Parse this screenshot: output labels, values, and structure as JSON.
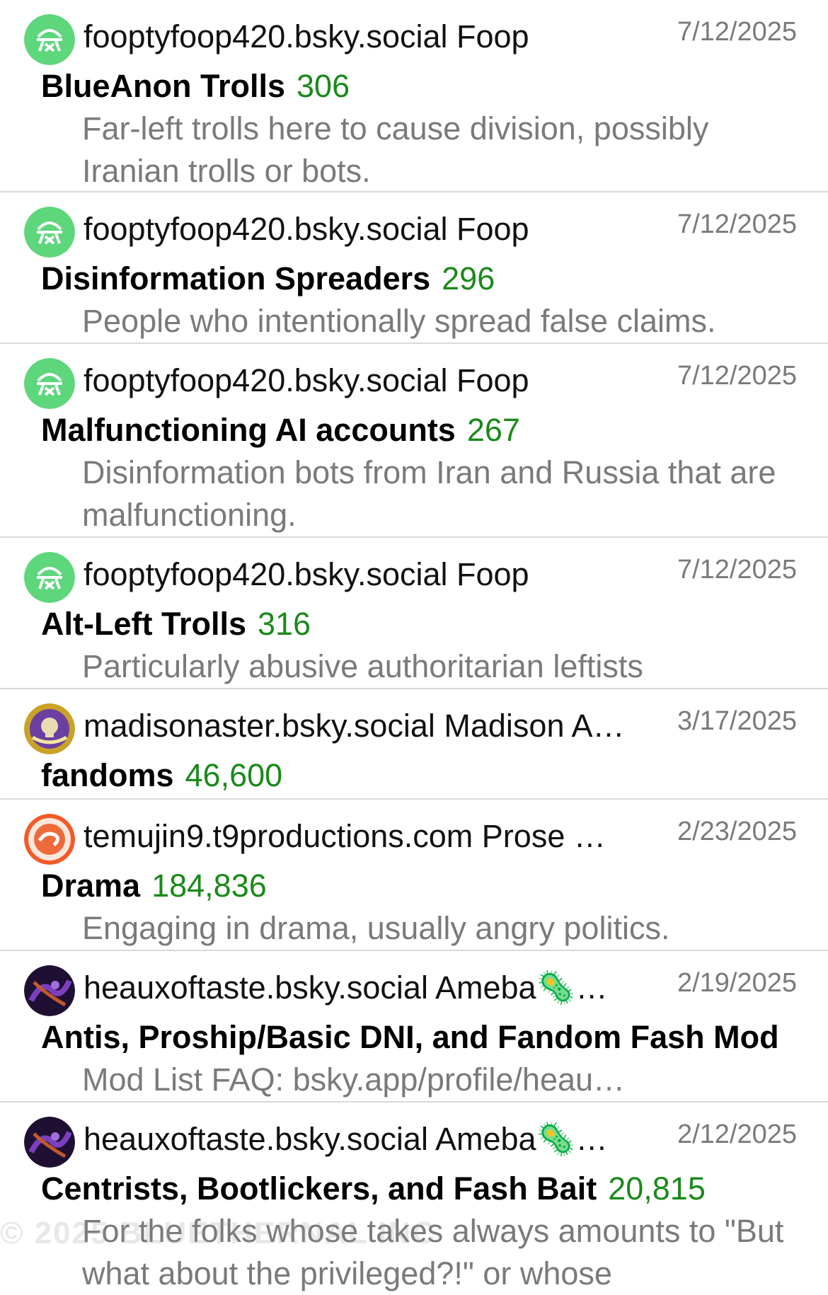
{
  "feeds": [
    {
      "author": "fooptyfoop420.bsky.social Foop",
      "date": "7/12/2025",
      "title": "BlueAnon Trolls",
      "count": "306",
      "description": "Far-left trolls here to cause division, possibly Iranian trolls or bots.",
      "avatar": "green-bsky-avatar"
    },
    {
      "author": "fooptyfoop420.bsky.social Foop",
      "date": "7/12/2025",
      "title": "Disinformation Spreaders",
      "count": "296",
      "description": "People who intentionally spread false claims.",
      "avatar": "green-bsky-avatar"
    },
    {
      "author": "fooptyfoop420.bsky.social Foop",
      "date": "7/12/2025",
      "title": "Malfunctioning AI accounts",
      "count": "267",
      "description": "Disinformation bots from Iran and Russia that are malfunctioning.",
      "avatar": "green-bsky-avatar"
    },
    {
      "author": "fooptyfoop420.bsky.social Foop",
      "date": "7/12/2025",
      "title": "Alt-Left Trolls",
      "count": "316",
      "description": "Particularly abusive authoritarian leftists",
      "avatar": "green-bsky-avatar"
    },
    {
      "author": "madisonaster.bsky.social Madison A…",
      "date": "3/17/2025",
      "title": "fandoms",
      "count": "46,600",
      "description": "",
      "avatar": "purple-gold-seal-avatar"
    },
    {
      "author": "temujin9.t9productions.com Prose …",
      "date": "2/23/2025",
      "title": "Drama",
      "count": "184,836",
      "description": "Engaging in drama, usually angry politics.",
      "avatar": "orange-swirl-avatar"
    },
    {
      "author": "heauxoftaste.bsky.social Ameba🦠…",
      "date": "2/19/2025",
      "title": "Antis, Proship/Basic DNI, and Fandom Fash Mod",
      "count": "",
      "description": "Mod List FAQ: bsky.app/profile/heau…",
      "avatar": "dark-purple-art-avatar"
    },
    {
      "author": "heauxoftaste.bsky.social Ameba🦠…",
      "date": "2/12/2025",
      "title": "Centrists, Bootlickers, and Fash Bait",
      "count": "20,815",
      "description": "For the folks whose takes always amounts to \"But what about the privileged?!\" or whose",
      "avatar": "dark-purple-art-avatar"
    }
  ],
  "watermark": "© 2025 BLUETHERNAL INC",
  "colors": {
    "count_green": "#1a8a1a",
    "muted_gray": "#7a7a7a",
    "divider": "#d9d9d9",
    "avatar_green": "#5ed67c"
  }
}
